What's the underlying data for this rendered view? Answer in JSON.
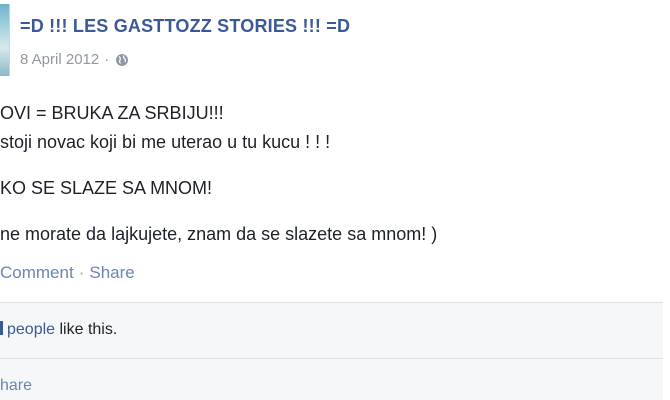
{
  "post": {
    "page_name": "=D !!! LES GASTTOZZ STORIES !!! =D",
    "date": "8 April 2012",
    "separator": "·",
    "privacy_icon": "globe-icon",
    "lines": [
      "OVI = BRUKA ZA SRBIJU!!!",
      "stoji novac koji bi me uterao u tu kucu ! ! !",
      "KO SE SLAZE SA MNOM!",
      " ne morate da lajkujete, znam da se slazete sa mnom! )"
    ]
  },
  "actions": {
    "comment": "Comment",
    "dot": "·",
    "share": "Share"
  },
  "ufi": {
    "people": "people",
    "likes_suffix": " like this.",
    "share_partial": "hare"
  },
  "colors": {
    "link": "#3b5998",
    "action_link": "#6d84b4",
    "meta_gray": "#9197a3",
    "ufi_bg": "#f6f7f9"
  }
}
